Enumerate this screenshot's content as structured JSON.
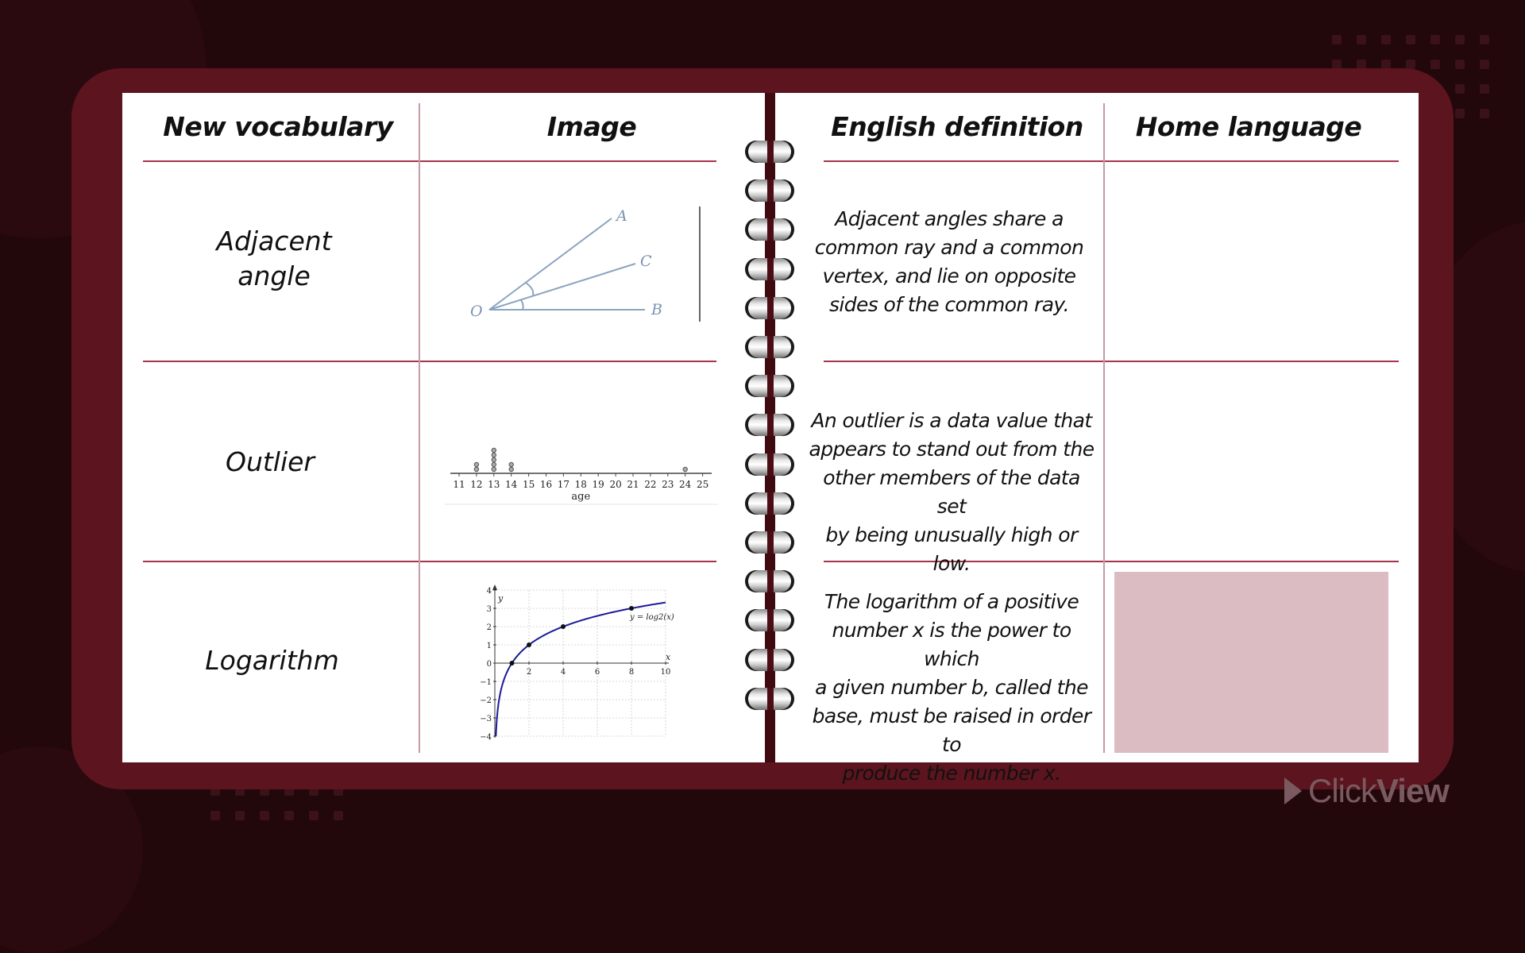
{
  "table": {
    "headers": [
      "New vocabulary",
      "Image",
      "English definition",
      "Home language"
    ],
    "rows": [
      {
        "term": "Adjacent angle",
        "term_lines": [
          "Adjacent",
          "angle"
        ],
        "image": "adjacent-angles-diagram",
        "definition": "Adjacent angles share a common ray and a common vertex, and lie on opposite sides of the common ray.",
        "definition_lines": [
          "Adjacent angles share a",
          "common ray and a common",
          "vertex, and lie on opposite",
          "sides of the common ray."
        ],
        "home_language": ""
      },
      {
        "term": "Outlier",
        "term_lines": [
          "Outlier"
        ],
        "image": "dot-plot-ages",
        "definition": "An outlier is a data value that appears to stand out from the other members of the data set by being unusually high or low.",
        "definition_lines": [
          "An outlier is a data value that",
          "appears to stand out from the",
          "other members of the data set",
          "by being unusually high or low."
        ],
        "home_language": ""
      },
      {
        "term": "Logarithm",
        "term_lines": [
          "Logarithm"
        ],
        "image": "log2-graph",
        "definition": "The logarithm of a positive number x is the power to which a given number b, called the base, must be raised in order to produce the number x.",
        "definition_lines": [
          "The logarithm of a positive",
          "number x is the power to which",
          "a given number b, called the",
          "base, must be raised in order to",
          "produce the number x."
        ],
        "home_language": "",
        "home_language_highlighted": true
      }
    ]
  },
  "angle_diagram": {
    "labels": {
      "vertex": "O",
      "ray1": "A",
      "ray2": "C",
      "ray3": "B"
    }
  },
  "dot_plot": {
    "axis_label": "age",
    "ticks": [
      11,
      12,
      13,
      14,
      15,
      16,
      17,
      18,
      19,
      20,
      21,
      22,
      23,
      24,
      25
    ],
    "counts": {
      "12": 2,
      "13": 5,
      "14": 2,
      "24": 1
    }
  },
  "log_graph": {
    "function_label": "y = log2(x)",
    "x_label": "x",
    "y_label": "y",
    "x_ticks": [
      2,
      4,
      6,
      8,
      10
    ],
    "y_ticks": [
      -4,
      -3,
      -2,
      -1,
      0,
      1,
      2,
      3,
      4
    ],
    "xlim": [
      0,
      10
    ],
    "ylim": [
      -4,
      4
    ],
    "points": [
      [
        1,
        0
      ],
      [
        2,
        1
      ],
      [
        4,
        2
      ],
      [
        8,
        3
      ]
    ]
  },
  "colors": {
    "background": "#22070b",
    "frame": "#5c141e",
    "divider": "#a6344a",
    "highlight": "#dcbcc3",
    "curve": "#1a1a9a"
  },
  "branding": {
    "logo_light": "Click",
    "logo_bold": "View"
  }
}
